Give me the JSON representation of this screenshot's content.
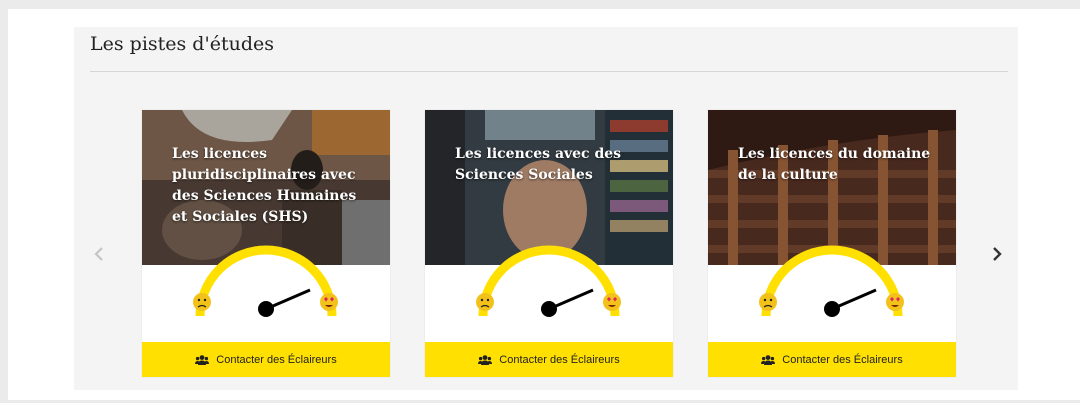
{
  "section": {
    "title": "Les pistes d'études"
  },
  "nav": {
    "prev_icon": "chevron-left-icon",
    "next_icon": "chevron-right-icon"
  },
  "cards": [
    {
      "title": "Les licences pluridisciplinaires avec des Sciences Humaines et Sociales (SHS)",
      "button_label": "Contacter des Éclaireurs",
      "button_icon": "users-icon",
      "gauge_level": 0.85
    },
    {
      "title": "Les licences avec des Sciences Sociales",
      "button_label": "Contacter des Éclaireurs",
      "button_icon": "users-icon",
      "gauge_level": 0.85
    },
    {
      "title": "Les licences du domaine de la culture",
      "button_label": "Contacter des Éclaireurs",
      "button_icon": "users-icon",
      "gauge_level": 0.85
    }
  ],
  "colors": {
    "accent": "#ffe000",
    "needle": "#000000",
    "panel": "#f4f4f4"
  }
}
